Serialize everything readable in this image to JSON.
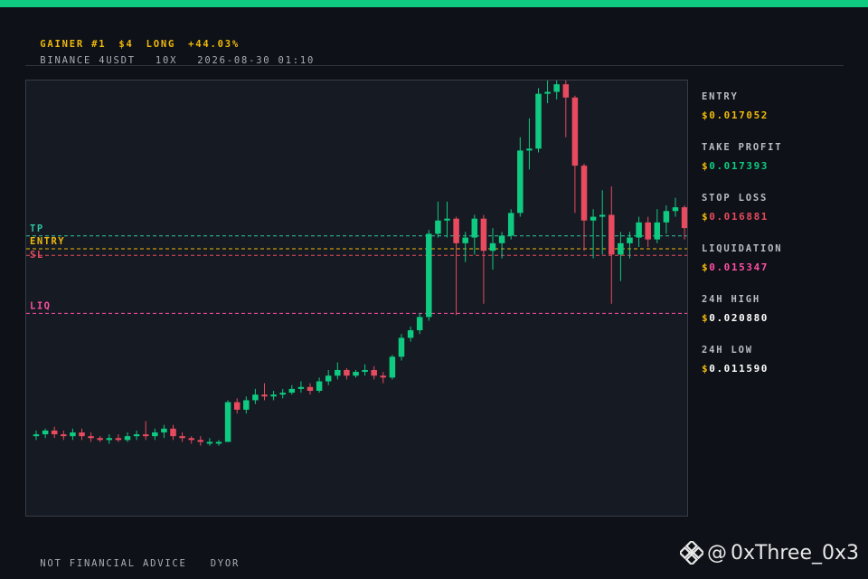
{
  "colors": {
    "up": "#0ecb81",
    "down": "#e84a5f",
    "gold": "#f0b90b",
    "liq": "#ff4fa5",
    "tp": "#2ec4a0",
    "sl": "#e84a5f"
  },
  "header": {
    "line1": [
      "GAINER #1",
      "$4",
      "LONG",
      "+44.03%"
    ],
    "line2": [
      "BINANCE 4USDT",
      "10X",
      "2026-08-30 01:10"
    ]
  },
  "stats": [
    {
      "label": "ENTRY",
      "value": "0.017052",
      "color": "#f0b90b"
    },
    {
      "label": "TAKE PROFIT",
      "value": "0.017393",
      "color": "#0ecb81"
    },
    {
      "label": "STOP LOSS",
      "value": "0.016881",
      "color": "#e84a5f"
    },
    {
      "label": "LIQUIDATION",
      "value": "0.015347",
      "color": "#ff4fa5"
    },
    {
      "label": "24H HIGH",
      "value": "0.020880",
      "color": "#ffffff"
    },
    {
      "label": "24H LOW",
      "value": "0.011590",
      "color": "#ffffff"
    }
  ],
  "currency_symbol": "$",
  "footer": [
    "NOT FINANCIAL ADVICE",
    "DYOR"
  ],
  "watermark": {
    "icon": "binance-logo-icon",
    "handle": "0xThree_0x3"
  },
  "chart_data": {
    "type": "candlestick",
    "y_range": [
      0.01,
      0.0215
    ],
    "levels": [
      {
        "label": "TP",
        "value": 0.017393
      },
      {
        "label": "ENTRY",
        "value": 0.017052
      },
      {
        "label": "SL",
        "value": 0.016881
      },
      {
        "label": "LIQ",
        "value": 0.015347
      }
    ],
    "candles": [
      [
        0.0121,
        0.01215,
        0.012,
        0.01225
      ],
      [
        0.01215,
        0.01225,
        0.01205,
        0.0123
      ],
      [
        0.01225,
        0.01215,
        0.01205,
        0.01235
      ],
      [
        0.01215,
        0.0121,
        0.012,
        0.01225
      ],
      [
        0.0121,
        0.0122,
        0.012,
        0.0123
      ],
      [
        0.0122,
        0.0121,
        0.012,
        0.0123
      ],
      [
        0.0121,
        0.01205,
        0.01195,
        0.0122
      ],
      [
        0.01205,
        0.012,
        0.01195,
        0.0121
      ],
      [
        0.012,
        0.01205,
        0.0119,
        0.01215
      ],
      [
        0.01205,
        0.012,
        0.01195,
        0.01215
      ],
      [
        0.012,
        0.0121,
        0.01195,
        0.0122
      ],
      [
        0.0121,
        0.01215,
        0.012,
        0.01225
      ],
      [
        0.01215,
        0.0121,
        0.012,
        0.0125
      ],
      [
        0.0121,
        0.0122,
        0.012,
        0.0123
      ],
      [
        0.0122,
        0.0123,
        0.01205,
        0.0124
      ],
      [
        0.0123,
        0.0121,
        0.012,
        0.0124
      ],
      [
        0.0121,
        0.01205,
        0.01195,
        0.0122
      ],
      [
        0.01205,
        0.012,
        0.0119,
        0.0121
      ],
      [
        0.012,
        0.01195,
        0.01185,
        0.0121
      ],
      [
        0.01195,
        0.01195,
        0.01185,
        0.01205
      ],
      [
        0.01195,
        0.01195,
        0.01185,
        0.012
      ],
      [
        0.01195,
        0.013,
        0.01195,
        0.01305
      ],
      [
        0.013,
        0.0128,
        0.0127,
        0.0131
      ],
      [
        0.0128,
        0.01305,
        0.0127,
        0.01315
      ],
      [
        0.01305,
        0.0132,
        0.01295,
        0.01335
      ],
      [
        0.0132,
        0.01315,
        0.01305,
        0.0135
      ],
      [
        0.01315,
        0.0132,
        0.01305,
        0.0133
      ],
      [
        0.0132,
        0.01325,
        0.0131,
        0.01335
      ],
      [
        0.01325,
        0.01335,
        0.0132,
        0.01345
      ],
      [
        0.01335,
        0.0134,
        0.01325,
        0.01355
      ],
      [
        0.0134,
        0.0133,
        0.0132,
        0.0135
      ],
      [
        0.0133,
        0.01355,
        0.01325,
        0.01365
      ],
      [
        0.01355,
        0.0137,
        0.01345,
        0.01385
      ],
      [
        0.0137,
        0.01385,
        0.0136,
        0.01405
      ],
      [
        0.01385,
        0.0137,
        0.0136,
        0.0139
      ],
      [
        0.0137,
        0.0138,
        0.01365,
        0.01385
      ],
      [
        0.0138,
        0.01385,
        0.0137,
        0.014
      ],
      [
        0.01385,
        0.0137,
        0.0136,
        0.01395
      ],
      [
        0.0137,
        0.01365,
        0.0135,
        0.0138
      ],
      [
        0.01365,
        0.0142,
        0.0136,
        0.01425
      ],
      [
        0.0142,
        0.0147,
        0.0141,
        0.0148
      ],
      [
        0.0147,
        0.0149,
        0.0146,
        0.015
      ],
      [
        0.0149,
        0.01525,
        0.0148,
        0.01535
      ],
      [
        0.01525,
        0.01745,
        0.01515,
        0.01755
      ],
      [
        0.01745,
        0.0178,
        0.01735,
        0.0183
      ],
      [
        0.0178,
        0.01785,
        0.01735,
        0.0183
      ],
      [
        0.01785,
        0.0172,
        0.0153,
        0.0179
      ],
      [
        0.0172,
        0.01735,
        0.0167,
        0.0175
      ],
      [
        0.01735,
        0.01785,
        0.0169,
        0.01795
      ],
      [
        0.01785,
        0.017,
        0.0156,
        0.01795
      ],
      [
        0.017,
        0.0172,
        0.0165,
        0.0176
      ],
      [
        0.0172,
        0.0174,
        0.0168,
        0.0175
      ],
      [
        0.0174,
        0.018,
        0.0173,
        0.0181
      ],
      [
        0.018,
        0.01965,
        0.0179,
        0.02
      ],
      [
        0.01965,
        0.0197,
        0.01915,
        0.0205
      ],
      [
        0.0197,
        0.02115,
        0.0196,
        0.0213
      ],
      [
        0.02115,
        0.0212,
        0.0209,
        0.02175
      ],
      [
        0.0212,
        0.0214,
        0.021,
        0.0218
      ],
      [
        0.0214,
        0.02105,
        0.02,
        0.0215
      ],
      [
        0.02105,
        0.01925,
        0.018,
        0.0211
      ],
      [
        0.01925,
        0.0178,
        0.017,
        0.0193
      ],
      [
        0.0178,
        0.0179,
        0.0168,
        0.0181
      ],
      [
        0.0179,
        0.01795,
        0.0169,
        0.0186
      ],
      [
        0.01795,
        0.0169,
        0.0156,
        0.0187
      ],
      [
        0.0169,
        0.0172,
        0.0162,
        0.0175
      ],
      [
        0.0172,
        0.01735,
        0.0168,
        0.0175
      ],
      [
        0.01735,
        0.01775,
        0.0171,
        0.0179
      ],
      [
        0.01775,
        0.0173,
        0.0171,
        0.0179
      ],
      [
        0.0173,
        0.01775,
        0.0172,
        0.0181
      ],
      [
        0.01775,
        0.01805,
        0.01745,
        0.0182
      ],
      [
        0.01805,
        0.01815,
        0.0179,
        0.0184
      ],
      [
        0.01815,
        0.0176,
        0.0173,
        0.0182
      ]
    ]
  }
}
